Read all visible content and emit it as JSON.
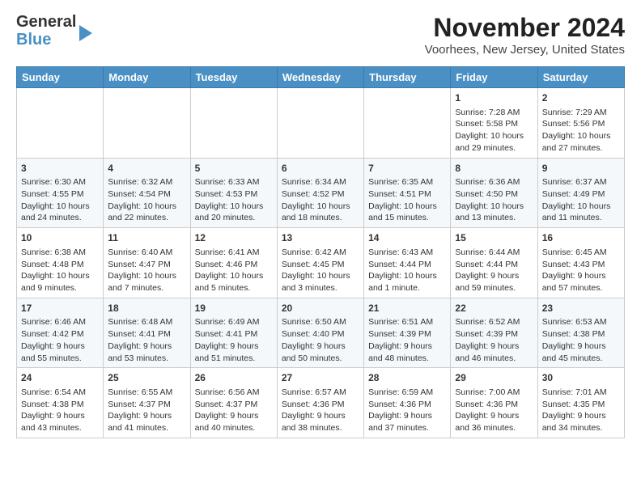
{
  "header": {
    "logo_general": "General",
    "logo_blue": "Blue",
    "month_title": "November 2024",
    "location": "Voorhees, New Jersey, United States"
  },
  "weekdays": [
    "Sunday",
    "Monday",
    "Tuesday",
    "Wednesday",
    "Thursday",
    "Friday",
    "Saturday"
  ],
  "weeks": [
    [
      {
        "day": "",
        "sunrise": "",
        "sunset": "",
        "daylight": ""
      },
      {
        "day": "",
        "sunrise": "",
        "sunset": "",
        "daylight": ""
      },
      {
        "day": "",
        "sunrise": "",
        "sunset": "",
        "daylight": ""
      },
      {
        "day": "",
        "sunrise": "",
        "sunset": "",
        "daylight": ""
      },
      {
        "day": "",
        "sunrise": "",
        "sunset": "",
        "daylight": ""
      },
      {
        "day": "1",
        "sunrise": "Sunrise: 7:28 AM",
        "sunset": "Sunset: 5:58 PM",
        "daylight": "Daylight: 10 hours and 29 minutes."
      },
      {
        "day": "2",
        "sunrise": "Sunrise: 7:29 AM",
        "sunset": "Sunset: 5:56 PM",
        "daylight": "Daylight: 10 hours and 27 minutes."
      }
    ],
    [
      {
        "day": "3",
        "sunrise": "Sunrise: 6:30 AM",
        "sunset": "Sunset: 4:55 PM",
        "daylight": "Daylight: 10 hours and 24 minutes."
      },
      {
        "day": "4",
        "sunrise": "Sunrise: 6:32 AM",
        "sunset": "Sunset: 4:54 PM",
        "daylight": "Daylight: 10 hours and 22 minutes."
      },
      {
        "day": "5",
        "sunrise": "Sunrise: 6:33 AM",
        "sunset": "Sunset: 4:53 PM",
        "daylight": "Daylight: 10 hours and 20 minutes."
      },
      {
        "day": "6",
        "sunrise": "Sunrise: 6:34 AM",
        "sunset": "Sunset: 4:52 PM",
        "daylight": "Daylight: 10 hours and 18 minutes."
      },
      {
        "day": "7",
        "sunrise": "Sunrise: 6:35 AM",
        "sunset": "Sunset: 4:51 PM",
        "daylight": "Daylight: 10 hours and 15 minutes."
      },
      {
        "day": "8",
        "sunrise": "Sunrise: 6:36 AM",
        "sunset": "Sunset: 4:50 PM",
        "daylight": "Daylight: 10 hours and 13 minutes."
      },
      {
        "day": "9",
        "sunrise": "Sunrise: 6:37 AM",
        "sunset": "Sunset: 4:49 PM",
        "daylight": "Daylight: 10 hours and 11 minutes."
      }
    ],
    [
      {
        "day": "10",
        "sunrise": "Sunrise: 6:38 AM",
        "sunset": "Sunset: 4:48 PM",
        "daylight": "Daylight: 10 hours and 9 minutes."
      },
      {
        "day": "11",
        "sunrise": "Sunrise: 6:40 AM",
        "sunset": "Sunset: 4:47 PM",
        "daylight": "Daylight: 10 hours and 7 minutes."
      },
      {
        "day": "12",
        "sunrise": "Sunrise: 6:41 AM",
        "sunset": "Sunset: 4:46 PM",
        "daylight": "Daylight: 10 hours and 5 minutes."
      },
      {
        "day": "13",
        "sunrise": "Sunrise: 6:42 AM",
        "sunset": "Sunset: 4:45 PM",
        "daylight": "Daylight: 10 hours and 3 minutes."
      },
      {
        "day": "14",
        "sunrise": "Sunrise: 6:43 AM",
        "sunset": "Sunset: 4:44 PM",
        "daylight": "Daylight: 10 hours and 1 minute."
      },
      {
        "day": "15",
        "sunrise": "Sunrise: 6:44 AM",
        "sunset": "Sunset: 4:44 PM",
        "daylight": "Daylight: 9 hours and 59 minutes."
      },
      {
        "day": "16",
        "sunrise": "Sunrise: 6:45 AM",
        "sunset": "Sunset: 4:43 PM",
        "daylight": "Daylight: 9 hours and 57 minutes."
      }
    ],
    [
      {
        "day": "17",
        "sunrise": "Sunrise: 6:46 AM",
        "sunset": "Sunset: 4:42 PM",
        "daylight": "Daylight: 9 hours and 55 minutes."
      },
      {
        "day": "18",
        "sunrise": "Sunrise: 6:48 AM",
        "sunset": "Sunset: 4:41 PM",
        "daylight": "Daylight: 9 hours and 53 minutes."
      },
      {
        "day": "19",
        "sunrise": "Sunrise: 6:49 AM",
        "sunset": "Sunset: 4:41 PM",
        "daylight": "Daylight: 9 hours and 51 minutes."
      },
      {
        "day": "20",
        "sunrise": "Sunrise: 6:50 AM",
        "sunset": "Sunset: 4:40 PM",
        "daylight": "Daylight: 9 hours and 50 minutes."
      },
      {
        "day": "21",
        "sunrise": "Sunrise: 6:51 AM",
        "sunset": "Sunset: 4:39 PM",
        "daylight": "Daylight: 9 hours and 48 minutes."
      },
      {
        "day": "22",
        "sunrise": "Sunrise: 6:52 AM",
        "sunset": "Sunset: 4:39 PM",
        "daylight": "Daylight: 9 hours and 46 minutes."
      },
      {
        "day": "23",
        "sunrise": "Sunrise: 6:53 AM",
        "sunset": "Sunset: 4:38 PM",
        "daylight": "Daylight: 9 hours and 45 minutes."
      }
    ],
    [
      {
        "day": "24",
        "sunrise": "Sunrise: 6:54 AM",
        "sunset": "Sunset: 4:38 PM",
        "daylight": "Daylight: 9 hours and 43 minutes."
      },
      {
        "day": "25",
        "sunrise": "Sunrise: 6:55 AM",
        "sunset": "Sunset: 4:37 PM",
        "daylight": "Daylight: 9 hours and 41 minutes."
      },
      {
        "day": "26",
        "sunrise": "Sunrise: 6:56 AM",
        "sunset": "Sunset: 4:37 PM",
        "daylight": "Daylight: 9 hours and 40 minutes."
      },
      {
        "day": "27",
        "sunrise": "Sunrise: 6:57 AM",
        "sunset": "Sunset: 4:36 PM",
        "daylight": "Daylight: 9 hours and 38 minutes."
      },
      {
        "day": "28",
        "sunrise": "Sunrise: 6:59 AM",
        "sunset": "Sunset: 4:36 PM",
        "daylight": "Daylight: 9 hours and 37 minutes."
      },
      {
        "day": "29",
        "sunrise": "Sunrise: 7:00 AM",
        "sunset": "Sunset: 4:36 PM",
        "daylight": "Daylight: 9 hours and 36 minutes."
      },
      {
        "day": "30",
        "sunrise": "Sunrise: 7:01 AM",
        "sunset": "Sunset: 4:35 PM",
        "daylight": "Daylight: 9 hours and 34 minutes."
      }
    ]
  ]
}
